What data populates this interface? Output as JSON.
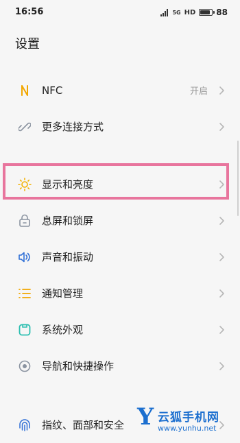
{
  "status_bar": {
    "time": "16:56",
    "signal_label": "5G",
    "wifi_label": "HD",
    "battery": "88"
  },
  "page_title": "设置",
  "groups": {
    "connect": [
      {
        "label": "NFC",
        "value": "开启",
        "icon": "nfc-icon"
      },
      {
        "label": "更多连接方式",
        "icon": "link-icon"
      }
    ],
    "display": [
      {
        "label": "显示和亮度",
        "icon": "sun-icon"
      },
      {
        "label": "息屏和锁屏",
        "icon": "lock-icon"
      },
      {
        "label": "声音和振动",
        "icon": "speaker-icon"
      },
      {
        "label": "通知管理",
        "icon": "list-icon"
      },
      {
        "label": "系统外观",
        "icon": "theme-icon"
      },
      {
        "label": "导航和快捷操作",
        "icon": "navigation-icon"
      }
    ],
    "security": [
      {
        "label": "指纹、面部和安全",
        "icon": "fingerprint-icon"
      }
    ]
  },
  "watermark": {
    "letter": "Y",
    "name": "云狐手机网",
    "url": "www.yunhu.net"
  },
  "colors": {
    "highlight": "#e8759d",
    "nfc": "#f2a700",
    "sun": "#f2b100",
    "speaker": "#2f6fd6",
    "list": "#f2a700",
    "theme": "#2bbfb0",
    "gray_icon": "#8a93a0",
    "watermark": "#1c6fcf"
  }
}
